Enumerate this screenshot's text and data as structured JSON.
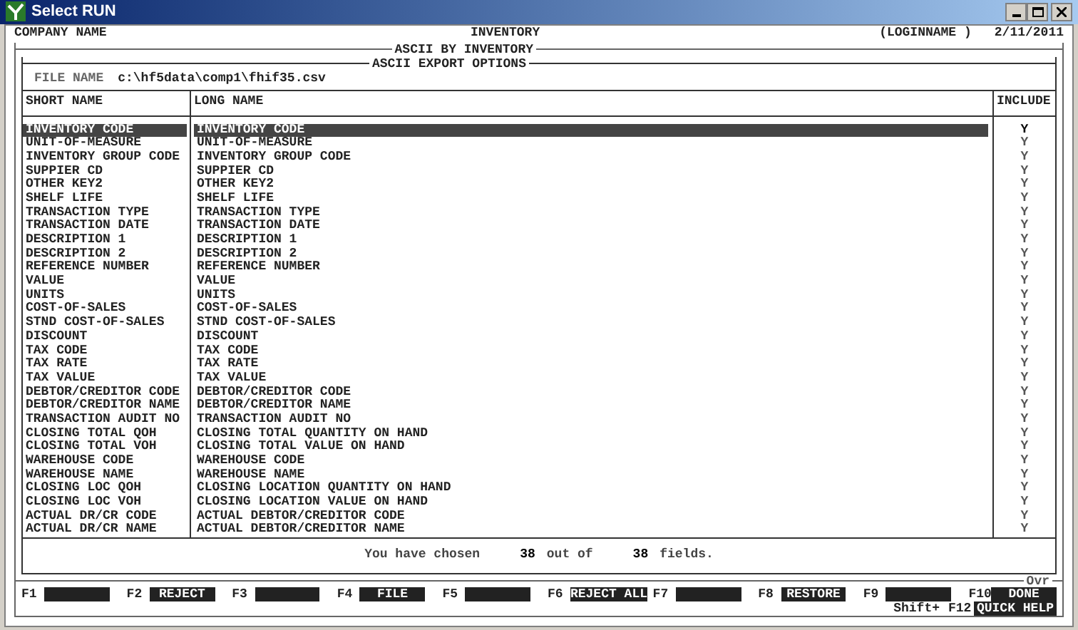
{
  "window": {
    "title": "Select RUN"
  },
  "header": {
    "company": "COMPANY NAME",
    "module": "INVENTORY",
    "user": "(LOGINNAME )",
    "date": "2/11/2011"
  },
  "outer_panel": {
    "title": "ASCII BY INVENTORY"
  },
  "inner_panel": {
    "title": "ASCII EXPORT OPTIONS"
  },
  "file": {
    "label": "FILE NAME",
    "value": "c:\\hf5data\\comp1\\fhif35.csv"
  },
  "table": {
    "columns": [
      "SHORT NAME",
      "LONG NAME",
      "INCLUDE"
    ],
    "rows": [
      {
        "short": "INVENTORY CODE",
        "long": "INVENTORY CODE",
        "include": "Y",
        "selected": true
      },
      {
        "short": "UNIT-OF-MEASURE",
        "long": "UNIT-OF-MEASURE",
        "include": "Y",
        "selected": false
      },
      {
        "short": "INVENTORY GROUP CODE",
        "long": "INVENTORY GROUP CODE",
        "include": "Y",
        "selected": false
      },
      {
        "short": "SUPPIER CD",
        "long": "SUPPIER CD",
        "include": "Y",
        "selected": false
      },
      {
        "short": "OTHER KEY2",
        "long": "OTHER KEY2",
        "include": "Y",
        "selected": false
      },
      {
        "short": "SHELF LIFE",
        "long": "SHELF LIFE",
        "include": "Y",
        "selected": false
      },
      {
        "short": "TRANSACTION TYPE",
        "long": "TRANSACTION TYPE",
        "include": "Y",
        "selected": false
      },
      {
        "short": "TRANSACTION DATE",
        "long": "TRANSACTION DATE",
        "include": "Y",
        "selected": false
      },
      {
        "short": "DESCRIPTION 1",
        "long": "DESCRIPTION 1",
        "include": "Y",
        "selected": false
      },
      {
        "short": "DESCRIPTION 2",
        "long": "DESCRIPTION 2",
        "include": "Y",
        "selected": false
      },
      {
        "short": "REFERENCE NUMBER",
        "long": "REFERENCE NUMBER",
        "include": "Y",
        "selected": false
      },
      {
        "short": "VALUE",
        "long": "VALUE",
        "include": "Y",
        "selected": false
      },
      {
        "short": "UNITS",
        "long": "UNITS",
        "include": "Y",
        "selected": false
      },
      {
        "short": "COST-OF-SALES",
        "long": "COST-OF-SALES",
        "include": "Y",
        "selected": false
      },
      {
        "short": "STND COST-OF-SALES",
        "long": "STND COST-OF-SALES",
        "include": "Y",
        "selected": false
      },
      {
        "short": "DISCOUNT",
        "long": "DISCOUNT",
        "include": "Y",
        "selected": false
      },
      {
        "short": "TAX CODE",
        "long": "TAX CODE",
        "include": "Y",
        "selected": false
      },
      {
        "short": "TAX RATE",
        "long": "TAX RATE",
        "include": "Y",
        "selected": false
      },
      {
        "short": "TAX VALUE",
        "long": "TAX VALUE",
        "include": "Y",
        "selected": false
      },
      {
        "short": "DEBTOR/CREDITOR CODE",
        "long": "DEBTOR/CREDITOR CODE",
        "include": "Y",
        "selected": false
      },
      {
        "short": "DEBTOR/CREDITOR NAME",
        "long": "DEBTOR/CREDITOR NAME",
        "include": "Y",
        "selected": false
      },
      {
        "short": "TRANSACTION AUDIT NO",
        "long": "TRANSACTION AUDIT NO",
        "include": "Y",
        "selected": false
      },
      {
        "short": "CLOSING TOTAL QOH",
        "long": "CLOSING TOTAL QUANTITY ON HAND",
        "include": "Y",
        "selected": false
      },
      {
        "short": "CLOSING TOTAL VOH",
        "long": "CLOSING TOTAL VALUE ON HAND",
        "include": "Y",
        "selected": false
      },
      {
        "short": "WAREHOUSE CODE",
        "long": "WAREHOUSE CODE",
        "include": "Y",
        "selected": false
      },
      {
        "short": "WAREHOUSE NAME",
        "long": "WAREHOUSE NAME",
        "include": "Y",
        "selected": false
      },
      {
        "short": "CLOSING LOC QOH",
        "long": "CLOSING LOCATION QUANTITY ON HAND",
        "include": "Y",
        "selected": false
      },
      {
        "short": "CLOSING LOC VOH",
        "long": "CLOSING LOCATION VALUE ON HAND",
        "include": "Y",
        "selected": false
      },
      {
        "short": "ACTUAL DR/CR CODE",
        "long": "ACTUAL DEBTOR/CREDITOR CODE",
        "include": "Y",
        "selected": false
      },
      {
        "short": "ACTUAL DR/CR NAME",
        "long": "ACTUAL DEBTOR/CREDITOR NAME",
        "include": "Y",
        "selected": false
      }
    ]
  },
  "summary": {
    "prefix": "You have chosen",
    "chosen": "38",
    "middle": "out of",
    "total": "38",
    "suffix": "fields."
  },
  "mode": "Ovr",
  "function_keys": [
    {
      "key": "F1"
    },
    {
      "key": "F2",
      "label": "REJECT"
    },
    {
      "key": "F3"
    },
    {
      "key": "F4",
      "label": "FILE"
    },
    {
      "key": "F5"
    },
    {
      "key": "F6",
      "label": "REJECT ALL"
    },
    {
      "key": "F7"
    },
    {
      "key": "F8",
      "label": "RESTORE"
    },
    {
      "key": "F9"
    },
    {
      "key": "F10",
      "label": "DONE"
    }
  ],
  "shift_keys": [
    {
      "modifier": "Shift+",
      "key": "F12",
      "label": "QUICK HELP"
    }
  ]
}
